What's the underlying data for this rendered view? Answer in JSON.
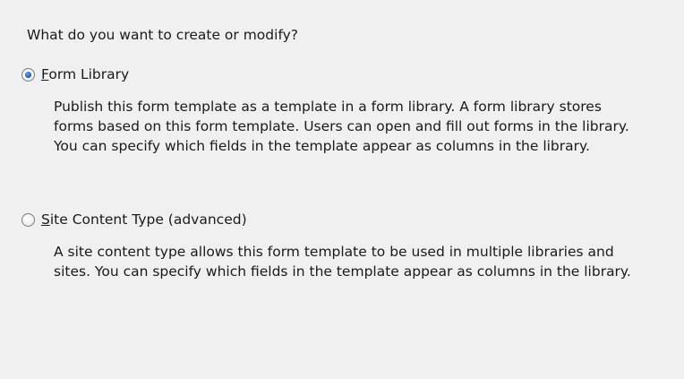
{
  "dialog": {
    "question": "What do you want to create or modify?",
    "options": [
      {
        "accelerator": "F",
        "label_rest": "orm Library",
        "selected": true,
        "description": "Publish this form template as a template in a form library. A form library stores forms based on this form template. Users can open and fill out forms in the library. You can specify which fields in the template appear as columns in the library."
      },
      {
        "accelerator": "S",
        "label_rest": "ite Content Type (advanced)",
        "selected": false,
        "description": "A site content type allows this form template to be used in multiple libraries and sites. You can specify which fields in the template appear as columns in the library."
      }
    ]
  },
  "colors": {
    "background": "#f0f0f0",
    "text": "#1a1a1a",
    "radio_dot": "#1c5fb8"
  }
}
